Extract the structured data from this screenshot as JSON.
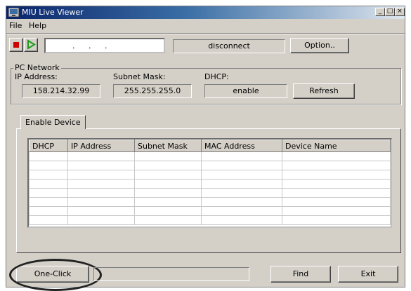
{
  "window": {
    "title": "MIU Live Viewer"
  },
  "menu": {
    "file": "File",
    "help": "Help"
  },
  "toolbar": {
    "stop_icon": "stop-icon",
    "play_icon": "play-icon",
    "ip_value": ".    .    .",
    "status": "disconnect",
    "option_label": "Option.."
  },
  "pc_network": {
    "title": "PC Network",
    "ip_label": "IP Address:",
    "ip_value": "158.214.32.99",
    "subnet_label": "Subnet Mask:",
    "subnet_value": "255.255.255.0",
    "dhcp_label": "DHCP:",
    "dhcp_value": "enable",
    "refresh_label": "Refresh"
  },
  "devices": {
    "tab_label": "Enable Device",
    "columns": [
      "DHCP",
      "IP Address",
      "Subnet Mask",
      "MAC Address",
      "Device Name"
    ],
    "rows": 8
  },
  "footer": {
    "one_click_label": "One-Click",
    "find_label": "Find",
    "exit_label": "Exit"
  },
  "colors": {
    "titlebar_start": "#0a246a",
    "face": "#d4d0c8",
    "stop_red": "#cc0000",
    "play_green": "#1a9a1a"
  }
}
